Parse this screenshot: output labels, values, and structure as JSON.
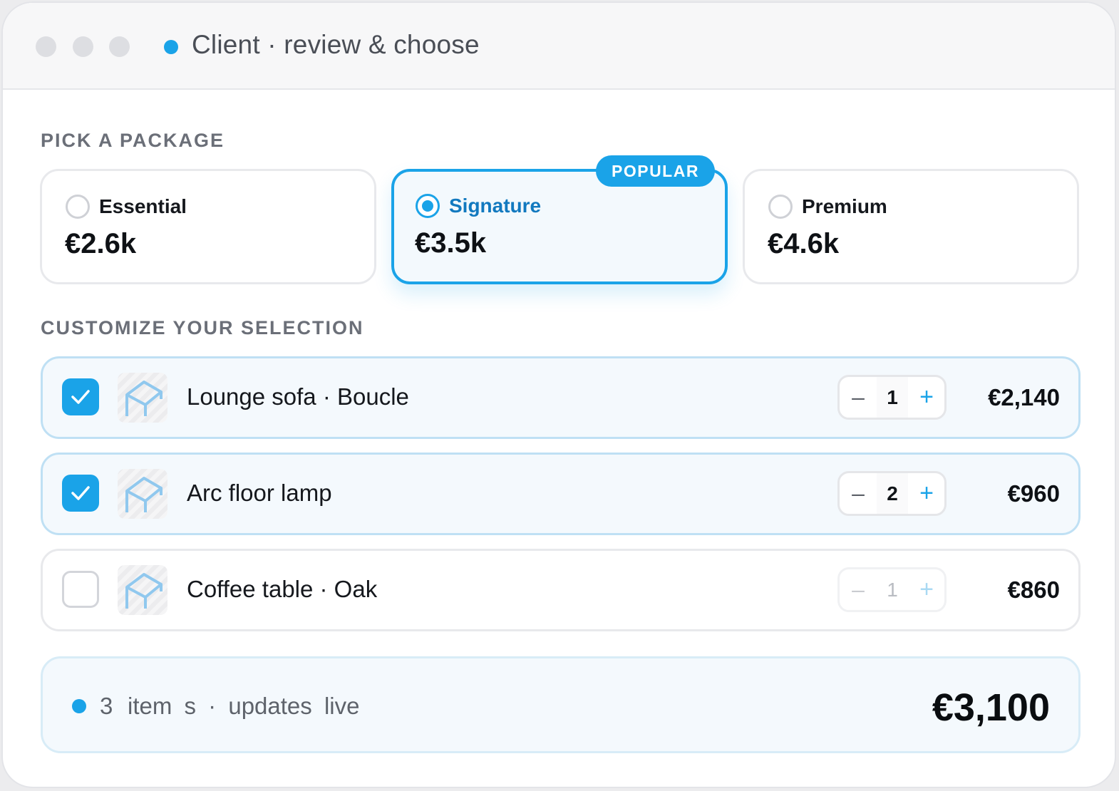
{
  "window": {
    "title": "Client · review & choose"
  },
  "packages": {
    "section_label": "PICK A PACKAGE",
    "items": [
      {
        "name": "Essential",
        "price": "€2.6k",
        "selected": false
      },
      {
        "name": "Signature",
        "price": "€3.5k",
        "selected": true,
        "badge": "POPULAR"
      },
      {
        "name": "Premium",
        "price": "€4.6k",
        "selected": false
      }
    ]
  },
  "customize": {
    "section_label": "CUSTOMIZE YOUR SELECTION",
    "items": [
      {
        "name": "Lounge sofa · Boucle",
        "qty": "1",
        "price": "€2,140",
        "checked": true
      },
      {
        "name": "Arc floor lamp",
        "qty": "2",
        "price": "€960",
        "checked": true
      },
      {
        "name": "Coffee table · Oak",
        "qty": "1",
        "price": "€860",
        "checked": false
      }
    ],
    "stepper": {
      "minus": "–",
      "plus": "+"
    }
  },
  "summary": {
    "count": "3",
    "label": "item s · updates live",
    "total": "€3,100"
  },
  "icons": {
    "checkmark": "check-icon",
    "thumbnail": "furniture-placeholder-icon",
    "radio": "radio-icon"
  },
  "colors": {
    "accent": "#1aa3e8",
    "accent_dark_text": "#1279bf",
    "selected_bg": "#f3f9fd",
    "border": "#e8e9ec"
  }
}
